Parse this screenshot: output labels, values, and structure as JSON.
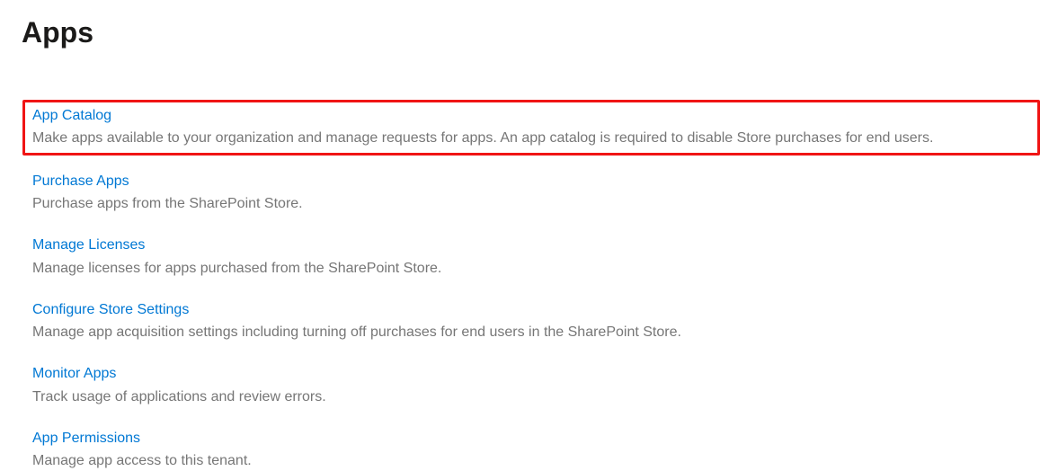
{
  "page": {
    "title": "Apps"
  },
  "items": [
    {
      "label": "App Catalog",
      "description": "Make apps available to your organization and manage requests for apps. An app catalog is required to disable Store purchases for end users."
    },
    {
      "label": "Purchase Apps",
      "description": "Purchase apps from the SharePoint Store."
    },
    {
      "label": "Manage Licenses",
      "description": "Manage licenses for apps purchased from the SharePoint Store."
    },
    {
      "label": "Configure Store Settings",
      "description": "Manage app acquisition settings including turning off purchases for end users in the SharePoint Store."
    },
    {
      "label": "Monitor Apps",
      "description": "Track usage of applications and review errors."
    },
    {
      "label": "App Permissions",
      "description": "Manage app access to this tenant."
    }
  ]
}
